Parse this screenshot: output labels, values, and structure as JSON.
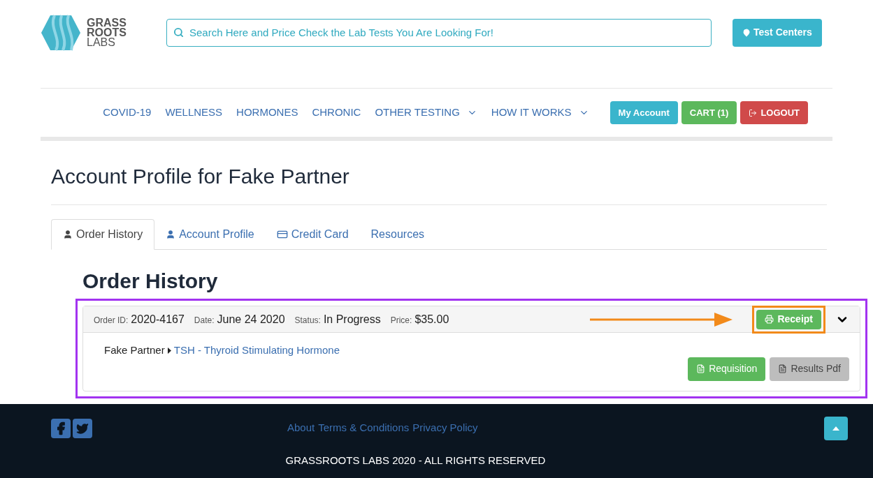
{
  "header": {
    "logo": {
      "line1": "GRASS",
      "line2": "ROOTS",
      "line3": "LABS"
    },
    "search": {
      "placeholder": "Search Here and Price Check the Lab Tests You Are Looking For!"
    },
    "test_centers": "Test Centers"
  },
  "nav": {
    "items": [
      {
        "label": "COVID-19",
        "dropdown": false
      },
      {
        "label": "WELLNESS",
        "dropdown": false
      },
      {
        "label": "HORMONES",
        "dropdown": false
      },
      {
        "label": "CHRONIC",
        "dropdown": false
      },
      {
        "label": "OTHER TESTING",
        "dropdown": true
      },
      {
        "label": "HOW IT WORKS",
        "dropdown": true
      }
    ],
    "buttons": [
      {
        "label": "My Account",
        "kind": "account"
      },
      {
        "label": "CART (1)",
        "kind": "cart"
      },
      {
        "label": "LOGOUT",
        "kind": "logout"
      }
    ]
  },
  "page_title": "Account Profile for Fake Partner",
  "tabs": [
    {
      "label": "Order History",
      "selected": true
    },
    {
      "label": "Account Profile",
      "selected": false
    },
    {
      "label": "Credit Card",
      "selected": false
    },
    {
      "label": "Resources",
      "selected": false
    }
  ],
  "section_title": "Order History",
  "order": {
    "fields": [
      {
        "label": "Order ID:",
        "value": "2020-4167"
      },
      {
        "label": "Date:",
        "value": "June 24 2020"
      },
      {
        "label": "Status:",
        "value": "In Progress"
      },
      {
        "label": "Price:",
        "value": "$35.00"
      }
    ],
    "receipt": "Receipt",
    "expanded": true,
    "patient": "Fake Partner",
    "test": "TSH - Thyroid Stimulating Hormone",
    "actions": [
      {
        "label": "Requisition",
        "disabled": false
      },
      {
        "label": "Results Pdf",
        "disabled": true
      }
    ]
  },
  "footer": {
    "links": [
      "About",
      "Terms & Conditions",
      "Privacy Policy"
    ],
    "copyright": "GRASSROOTS LABS 2020 - ALL RIGHTS RESERVED"
  }
}
